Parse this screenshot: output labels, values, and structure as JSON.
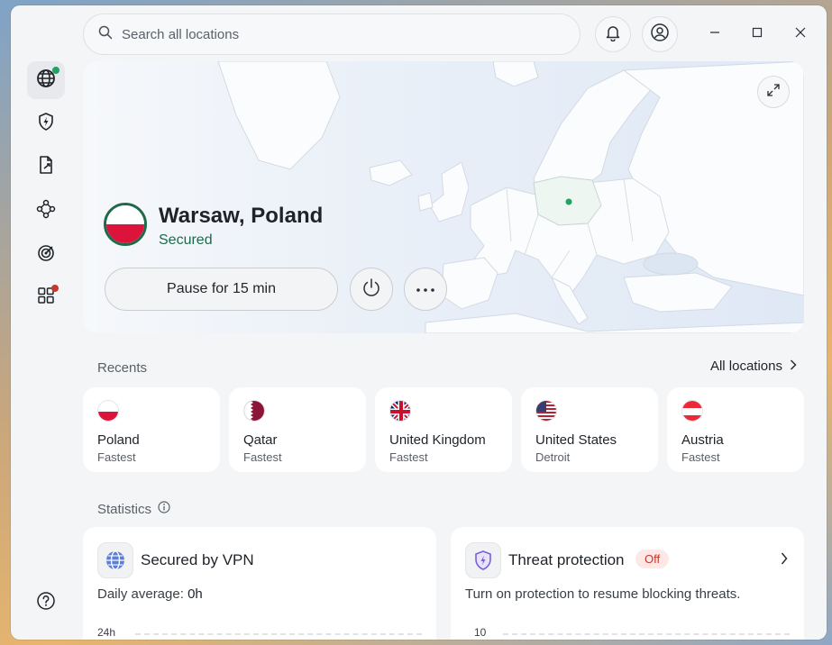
{
  "search": {
    "placeholder": "Search all locations"
  },
  "sidebar": {
    "items": [
      {
        "name": "globe",
        "active": true
      },
      {
        "name": "bolt-shield"
      },
      {
        "name": "file-share"
      },
      {
        "name": "mesh"
      },
      {
        "name": "radar"
      },
      {
        "name": "apps"
      }
    ]
  },
  "connection": {
    "location": "Warsaw, Poland",
    "status": "Secured",
    "pause_label": "Pause for 15 min"
  },
  "recents": {
    "label": "Recents",
    "all_locations_label": "All locations",
    "items": [
      {
        "country": "Poland",
        "sub": "Fastest",
        "flag": "poland"
      },
      {
        "country": "Qatar",
        "sub": "Fastest",
        "flag": "qatar"
      },
      {
        "country": "United Kingdom",
        "sub": "Fastest",
        "flag": "uk"
      },
      {
        "country": "United States",
        "sub": "Detroit",
        "flag": "us"
      },
      {
        "country": "Austria",
        "sub": "Fastest",
        "flag": "austria"
      }
    ]
  },
  "statistics": {
    "label": "Statistics",
    "vpn": {
      "title": "Secured by VPN",
      "daily_prefix": "Daily average: ",
      "daily_value": "0h",
      "axis_top": "24h"
    },
    "threat": {
      "title": "Threat protection",
      "badge": "Off",
      "subtitle": "Turn on protection to resume blocking threats.",
      "axis_top": "10"
    }
  },
  "colors": {
    "accent_green": "#1e6a4a",
    "status_dot_green": "#1ea363",
    "notify_red": "#c5372c"
  }
}
